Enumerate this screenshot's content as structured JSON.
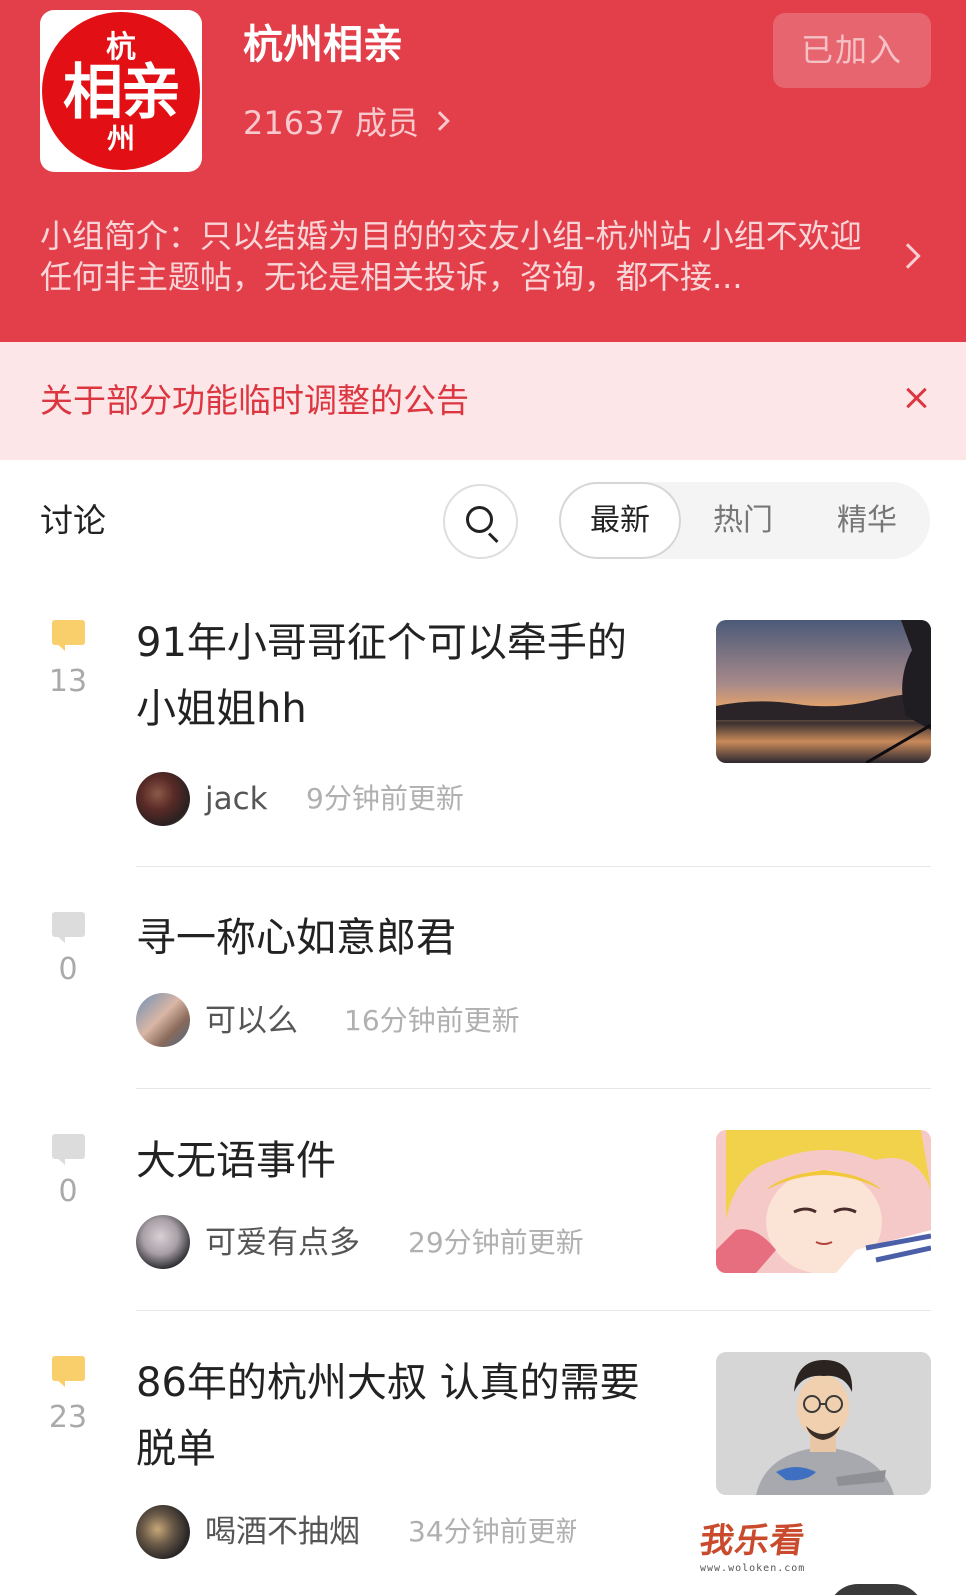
{
  "header": {
    "logo": {
      "line1": "杭",
      "line2": "相亲",
      "line3": "州"
    },
    "group_name": "杭州相亲",
    "members": "21637 成员",
    "join_button": "已加入",
    "intro": "小组简介：只以结婚为目的的交友小组-杭州站  小组不欢迎任何非主题帖，无论是相关投诉，咨询，都不接...",
    "colors": {
      "background": "#e23f4b"
    }
  },
  "notice": {
    "text": "关于部分功能临时调整的公告",
    "close_icon": "close-icon",
    "colors": {
      "background": "#fde6e8",
      "text": "#dc3640"
    }
  },
  "discussion": {
    "title": "讨论",
    "search_icon": "search-icon",
    "tabs": [
      "最新",
      "热门",
      "精华"
    ],
    "active_tab": "最新"
  },
  "posts": [
    {
      "count": "13",
      "title_line1": "91年小哥哥征个可以牵手的",
      "title_line2": "小姐姐hh",
      "author": "jack",
      "time": "9分钟前更新",
      "has_thumb": true,
      "thumb": "sunset-lake-photo",
      "hot": true
    },
    {
      "count": "0",
      "title_line1": "寻一称心如意郎君",
      "author": "可以么",
      "time": "16分钟前更新",
      "has_thumb": false,
      "hot": false
    },
    {
      "count": "0",
      "title_line1": "大无语事件",
      "author": "可爱有点多",
      "time": "29分钟前更新",
      "has_thumb": true,
      "thumb": "anime-girl-image",
      "hot": false
    },
    {
      "count": "23",
      "title_line1": "86年的杭州大叔 认真的需要",
      "title_line2": "脱单",
      "author": "喝酒不抽烟",
      "time": "34分钟前更新",
      "has_thumb": true,
      "thumb": "man-portrait-photo",
      "hot": true
    }
  ],
  "watermark": {
    "main": "我乐看",
    "sub": "www.woloken.com"
  }
}
